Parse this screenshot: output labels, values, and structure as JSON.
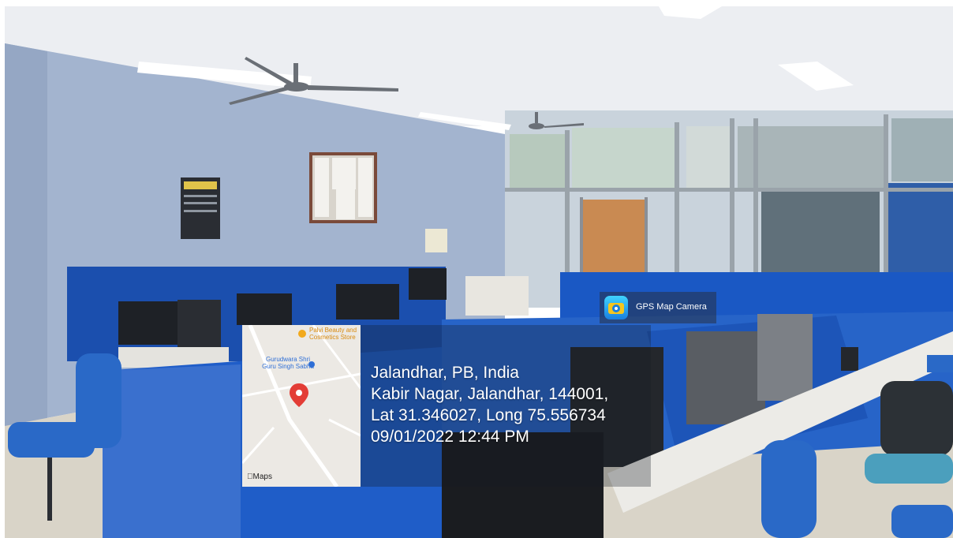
{
  "map": {
    "poi_beauty": "Palvi Beauty and Cosmetics Store",
    "poi_gurudwara": "Gurudwara Shri Guru Singh Sabha",
    "maps_label": "Maps"
  },
  "badge": {
    "label": "GPS Map Camera"
  },
  "location": {
    "line1": "Jalandhar, PB, India",
    "line2": "Kabir Nagar, Jalandhar, 144001,",
    "line3": "Lat 31.346027, Long 75.556734",
    "line4": "09/01/2022 12:44 PM"
  }
}
